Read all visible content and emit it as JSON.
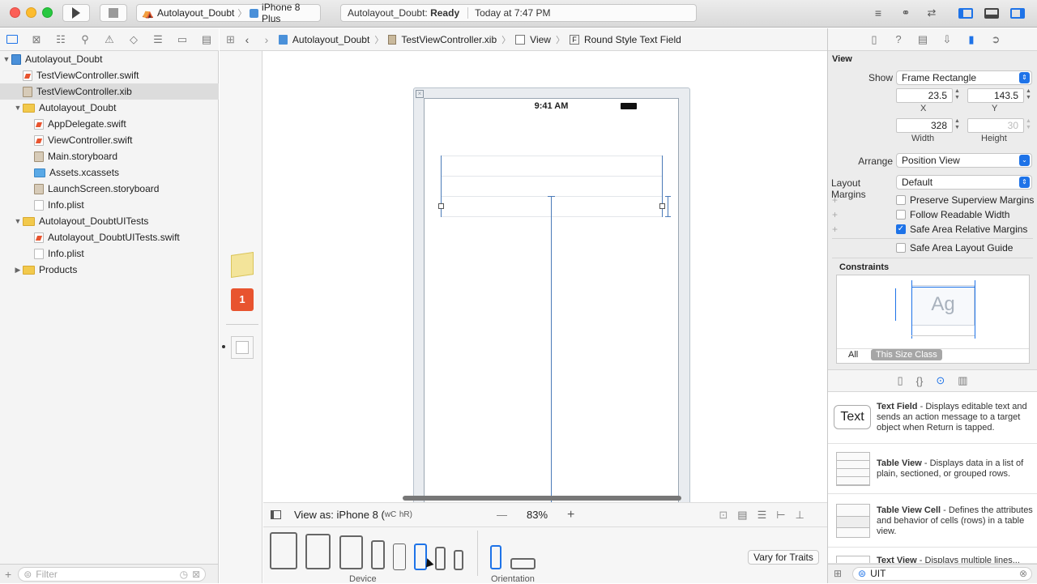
{
  "toolbar": {
    "scheme": "Autolayout_Doubt",
    "device": "iPhone 8 Plus",
    "status_project": "Autolayout_Doubt:",
    "status_state": "Ready",
    "status_time": "Today at 7:47 PM"
  },
  "navigator": {
    "items": [
      {
        "label": "Autolayout_Doubt",
        "indent": 0,
        "disc": "▼",
        "icon": "proj"
      },
      {
        "label": "TestViewController.swift",
        "indent": 1,
        "disc": "",
        "icon": "swift"
      },
      {
        "label": "TestViewController.xib",
        "indent": 1,
        "disc": "",
        "icon": "xib",
        "selected": true
      },
      {
        "label": "Autolayout_Doubt",
        "indent": 1,
        "disc": "▼",
        "icon": "folder"
      },
      {
        "label": "AppDelegate.swift",
        "indent": 2,
        "disc": "",
        "icon": "swift"
      },
      {
        "label": "ViewController.swift",
        "indent": 2,
        "disc": "",
        "icon": "swift"
      },
      {
        "label": "Main.storyboard",
        "indent": 2,
        "disc": "",
        "icon": "xib"
      },
      {
        "label": "Assets.xcassets",
        "indent": 2,
        "disc": "",
        "icon": "assets"
      },
      {
        "label": "LaunchScreen.storyboard",
        "indent": 2,
        "disc": "",
        "icon": "xib"
      },
      {
        "label": "Info.plist",
        "indent": 2,
        "disc": "",
        "icon": "plist"
      },
      {
        "label": "Autolayout_DoubtUITests",
        "indent": 1,
        "disc": "▼",
        "icon": "folder"
      },
      {
        "label": "Autolayout_DoubtUITests.swift",
        "indent": 2,
        "disc": "",
        "icon": "swift"
      },
      {
        "label": "Info.plist",
        "indent": 2,
        "disc": "",
        "icon": "plist"
      },
      {
        "label": "Products",
        "indent": 1,
        "disc": "▶",
        "icon": "folder"
      }
    ],
    "filter_placeholder": "Filter"
  },
  "jumpbar": {
    "project": "Autolayout_Doubt",
    "file": "TestViewController.xib",
    "view": "View",
    "element": "Round Style Text Field"
  },
  "canvas": {
    "status_time": "9:41 AM",
    "view_as": "View as: iPhone 8 (",
    "wc": "wC",
    "hr": "hR)",
    "zoom": "83%",
    "device_label": "Device",
    "orientation_label": "Orientation",
    "vary_button": "Vary for Traits"
  },
  "inspector": {
    "section": "View",
    "show_label": "Show",
    "show_value": "Frame Rectangle",
    "x_value": "23.5",
    "x_label": "X",
    "y_value": "143.5",
    "y_label": "Y",
    "width_value": "328",
    "width_label": "Width",
    "height_value": "30",
    "height_label": "Height",
    "arrange_label": "Arrange",
    "arrange_value": "Position View",
    "margins_label": "Layout Margins",
    "margins_value": "Default",
    "preserve": "Preserve Superview Margins",
    "readable": "Follow Readable Width",
    "safearea_margins": "Safe Area Relative Margins",
    "safearea_guide": "Safe Area Layout Guide",
    "constraints_title": "Constraints",
    "ag": "Ag",
    "all": "All",
    "size_class": "This Size Class"
  },
  "library": {
    "items": [
      {
        "icon_text": "Text",
        "title": "Text Field",
        "desc": "Displays editable text and sends an action message to a target object when Return is tapped."
      },
      {
        "icon_text": "",
        "title": "Table View",
        "desc": "Displays data in a list of plain, sectioned, or grouped rows."
      },
      {
        "icon_text": "",
        "title": "Table View Cell",
        "desc": "Defines the attributes and behavior of cells (rows) in a table view."
      },
      {
        "icon_text": "",
        "title": "Text View",
        "desc": "Displays multiple lines..."
      }
    ],
    "filter_value": "UIT"
  }
}
